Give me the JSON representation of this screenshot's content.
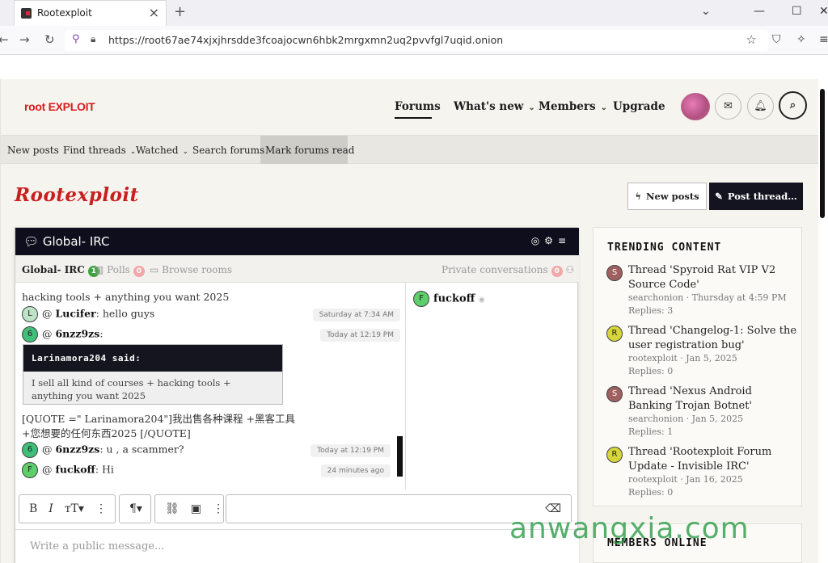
{
  "browser": {
    "tab_title": "Rootexploit",
    "tab_close": "×",
    "new_tab": "+",
    "url": "https://root67ae74xjxjhrsdde3fcoajocwn6hbk2mrgxmn2uq2pvvfgl7uqid.onion"
  },
  "site": {
    "logo_part1": "root ",
    "logo_part2": "EXPLOIT"
  },
  "main_nav": [
    {
      "label": "Forums"
    },
    {
      "label": "What's new"
    },
    {
      "label": "Members"
    },
    {
      "label": "Upgrade"
    }
  ],
  "sub_nav": {
    "new_posts": "New posts",
    "find_threads": "Find threads",
    "watched": "Watched",
    "search_forums": "Search forums",
    "mark_read": "Mark forums read"
  },
  "page_title": "Rootexploit",
  "actions": {
    "new_posts": "New posts",
    "post_thread": "Post thread…"
  },
  "irc": {
    "title": "Global- IRC",
    "tabs": {
      "global": "Global- IRC",
      "global_count": "1",
      "polls": "Polls",
      "polls_count": "0",
      "browse": "Browse rooms",
      "private": "Private conversations",
      "private_count": "0"
    },
    "messages": [
      {
        "text": "hacking tools + anything you want 2025"
      },
      {
        "avatar": "L",
        "user": "Lucifer",
        "text": ": hello guys",
        "time": "Saturday at 7:34 AM"
      },
      {
        "avatar": "6",
        "user": "6nzz9zs",
        "text": ":",
        "time": "Today at 12:19 PM"
      },
      {
        "quote_head": "Larinamora204 said:",
        "quote_body": "I sell all kind of courses + hacking tools + anything you want 2025"
      },
      {
        "text1": "[QUOTE =\" Larinamora204\"]我出售各种课程 +黑客工具",
        "text2": "+您想要的任何东西2025 [/QUOTE]"
      },
      {
        "avatar": "6",
        "user": "6nzz9zs",
        "text": ": u , a scammer?",
        "time": "Today at 12:19 PM"
      },
      {
        "avatar": "F",
        "user": "fuckoff",
        "text": ": Hi",
        "time": "24 minutes ago"
      }
    ],
    "online_users": [
      {
        "avatar": "F",
        "name": "fuckoff"
      }
    ],
    "composer_placeholder": "Write a public message..."
  },
  "trending": {
    "title": "TRENDING CONTENT",
    "items": [
      {
        "avatar": "S",
        "title": "Thread 'Spyroid Rat VIP V2 Source Code'",
        "meta": "searchonion · Thursday at 4:59 PM",
        "replies": "Replies: 3"
      },
      {
        "avatar": "R",
        "title": "Thread 'Changelog-1: Solve the user registration bug'",
        "meta": "rootexploit · Jan 5, 2025",
        "replies": "Replies: 0"
      },
      {
        "avatar": "S",
        "title": "Thread 'Nexus Android Banking Trojan Botnet'",
        "meta": "searchonion · Jan 5, 2025",
        "replies": "Replies: 1"
      },
      {
        "avatar": "R",
        "title": "Thread 'Rootexploit Forum Update - Invisible IRC'",
        "meta": "rootexploit · Jan 16, 2025",
        "replies": "Replies: 0"
      }
    ]
  },
  "members_online": "MEMBERS ONLINE",
  "watermark": "anwangxia.com",
  "colors": {
    "accent": "#c81f1f",
    "dark": "#0e0e1c",
    "page_bg": "#f6f4ef"
  }
}
